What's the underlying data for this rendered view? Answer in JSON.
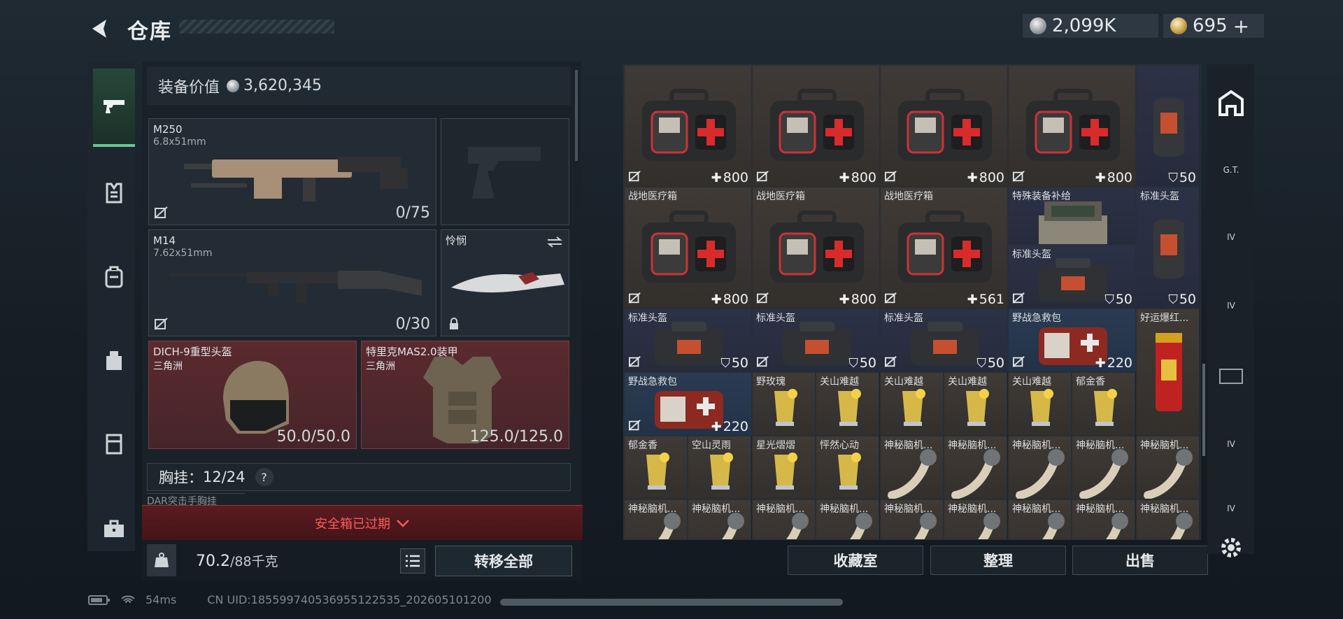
{
  "header": {
    "title": "仓库"
  },
  "currency": {
    "silver": "2,099K",
    "gold": "695",
    "add": "+"
  },
  "left_nav": {
    "icons": [
      "pistol-icon",
      "vest-icon",
      "backpack-icon",
      "bag-icon",
      "rig-icon",
      "briefcase-icon"
    ]
  },
  "loadout": {
    "value_label": "装备价值",
    "value": "3,620,345",
    "primary": {
      "name": "M250",
      "caliber": "6.8x51mm",
      "ammo": "0/75"
    },
    "secondary": {
      "name": "M14",
      "caliber": "7.62x51mm",
      "ammo": "0/30"
    },
    "melee": {
      "name": "怜悯"
    },
    "helmet": {
      "name": "DICH-9重型头盔",
      "origin": "三角洲",
      "durability": "50.0/50.0"
    },
    "armor": {
      "name": "特里克MAS2.0装甲",
      "origin": "三角洲",
      "durability": "125.0/125.0"
    },
    "chest_rig": {
      "label": "胸挂：",
      "count": "12/24",
      "help": "?",
      "item_name": "DAR突击手胸挂"
    },
    "safe_box": "安全箱已过期",
    "weight_value": "70.2",
    "weight_max": "/88千克",
    "transfer_all": "转移全部"
  },
  "status_bar": {
    "ping": "54ms",
    "uid": "CN UID:18559974053695512253​5_2026051012​00"
  },
  "inventory": {
    "items": [
      {
        "label": "",
        "value": "800",
        "icon": "medkit"
      },
      {
        "label": "",
        "value": "800",
        "icon": "medkit"
      },
      {
        "label": "",
        "value": "800",
        "icon": "medkit"
      },
      {
        "label": "",
        "value": "800",
        "icon": "medkit"
      },
      {
        "label": "",
        "value": "50",
        "icon": "helmet"
      },
      {
        "label": "战地医疗箱",
        "value": "800",
        "icon": "medkit"
      },
      {
        "label": "战地医疗箱",
        "value": "800",
        "icon": "medkit"
      },
      {
        "label": "战地医疗箱",
        "value": "561",
        "icon": "medkit"
      },
      {
        "label": "特殊装备补给",
        "value": "",
        "icon": "supply"
      },
      {
        "label": "标准头盔",
        "value": "50",
        "icon": "helmet"
      },
      {
        "label": "标准头盔",
        "value": "50",
        "icon": "helmet-bag"
      },
      {
        "label": "标准头盔",
        "value": "50",
        "icon": "helmet-bag"
      },
      {
        "label": "标准头盔",
        "value": "50",
        "icon": "helmet-bag"
      },
      {
        "label": "标准头盔",
        "value": "50",
        "icon": "helmet-bag"
      },
      {
        "label": "野战急救包",
        "value": "220",
        "icon": "firstaid"
      },
      {
        "label": "好运爆红...",
        "value": "",
        "icon": "firecracker"
      },
      {
        "label": "野战急救包",
        "value": "220",
        "icon": "firstaid"
      },
      {
        "label": "野玫瑰",
        "value": "",
        "icon": "cocktail"
      },
      {
        "label": "关山难越",
        "value": "",
        "icon": "cocktail"
      },
      {
        "label": "关山难越",
        "value": "",
        "icon": "cocktail"
      },
      {
        "label": "关山难越",
        "value": "",
        "icon": "cocktail"
      },
      {
        "label": "关山难越",
        "value": "",
        "icon": "cocktail"
      },
      {
        "label": "郁金香",
        "value": "",
        "icon": "cocktail"
      },
      {
        "label": "郁金香",
        "value": "",
        "icon": "cocktail"
      },
      {
        "label": "空山灵雨",
        "value": "",
        "icon": "cocktail"
      },
      {
        "label": "星光熠熠",
        "value": "",
        "icon": "cocktail"
      },
      {
        "label": "怦然心动",
        "value": "",
        "icon": "cocktail"
      },
      {
        "label": "神秘脑机...",
        "value": "",
        "icon": "horn"
      }
    ]
  },
  "right_nav": {
    "items": [
      "home-icon",
      "G.T.",
      "IV",
      "IV",
      "",
      "IV",
      "IV"
    ]
  },
  "grid_buttons": {
    "collection": "收藏室",
    "sort": "整理",
    "sell": "出售"
  },
  "colors": {
    "accent_green": "#6ac49a",
    "warning_red": "#ff5a5a"
  }
}
